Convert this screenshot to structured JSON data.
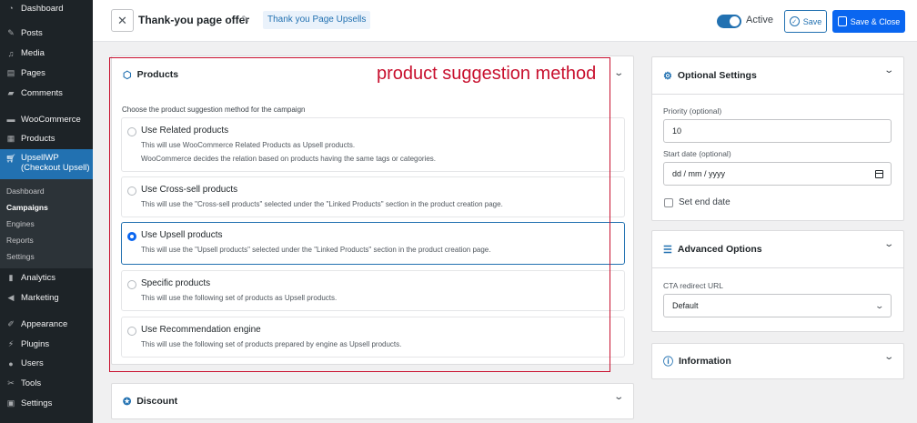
{
  "sidebar": {
    "dashboard": "Dashboard",
    "posts": "Posts",
    "media": "Media",
    "pages": "Pages",
    "comments": "Comments",
    "woocommerce": "WooCommerce",
    "products": "Products",
    "upsellwp": "UpsellWP",
    "upsellwp_sub": "(Checkout Upsell)",
    "submenu": [
      "Dashboard",
      "Campaigns",
      "Engines",
      "Reports",
      "Settings"
    ],
    "analytics": "Analytics",
    "marketing": "Marketing",
    "appearance": "Appearance",
    "plugins": "Plugins",
    "users": "Users",
    "tools": "Tools",
    "settings": "Settings"
  },
  "header": {
    "close": "✕",
    "title": "Thank-you page offer",
    "tag": "Thank you Page Upsells",
    "toggle_label": "Active",
    "save": "Save",
    "save_close": "Save & Close"
  },
  "products": {
    "title": "Products",
    "intro": "Choose the product suggestion method for the campaign",
    "options": [
      {
        "title": "Use Related products",
        "desc1": "This will use WooCommerce Related Products as Upsell products.",
        "desc2": "WooCommerce decides the relation based on products having the same tags or categories."
      },
      {
        "title": "Use Cross-sell products",
        "desc1": "This will use the \"Cross-sell products\" selected under the \"Linked Products\" section in the product creation page."
      },
      {
        "title": "Use Upsell products",
        "desc1": "This will use the \"Upsell products\" selected under the \"Linked Products\" section in the product creation page."
      },
      {
        "title": "Specific products",
        "desc1": "This will use the following set of products as Upsell products."
      },
      {
        "title": "Use Recommendation engine",
        "desc1": "This will use the following set of products prepared by engine as Upsell products."
      }
    ],
    "selected_index": 2
  },
  "annotation": "product suggestion method",
  "discount": {
    "title": "Discount"
  },
  "optional_settings": {
    "title": "Optional Settings",
    "priority_label": "Priority (optional)",
    "priority_value": "10",
    "start_date_label": "Start date (optional)",
    "start_date_placeholder": "dd / mm / yyyy",
    "end_date_label": "Set end date"
  },
  "advanced_options": {
    "title": "Advanced Options",
    "cta_label": "CTA redirect URL",
    "cta_value": "Default"
  },
  "information": {
    "title": "Information"
  },
  "colors": {
    "accent": "#2271b1",
    "primary_button": "#0a66f0",
    "annotation": "#c8102e",
    "sidebar": "#1d2327"
  }
}
